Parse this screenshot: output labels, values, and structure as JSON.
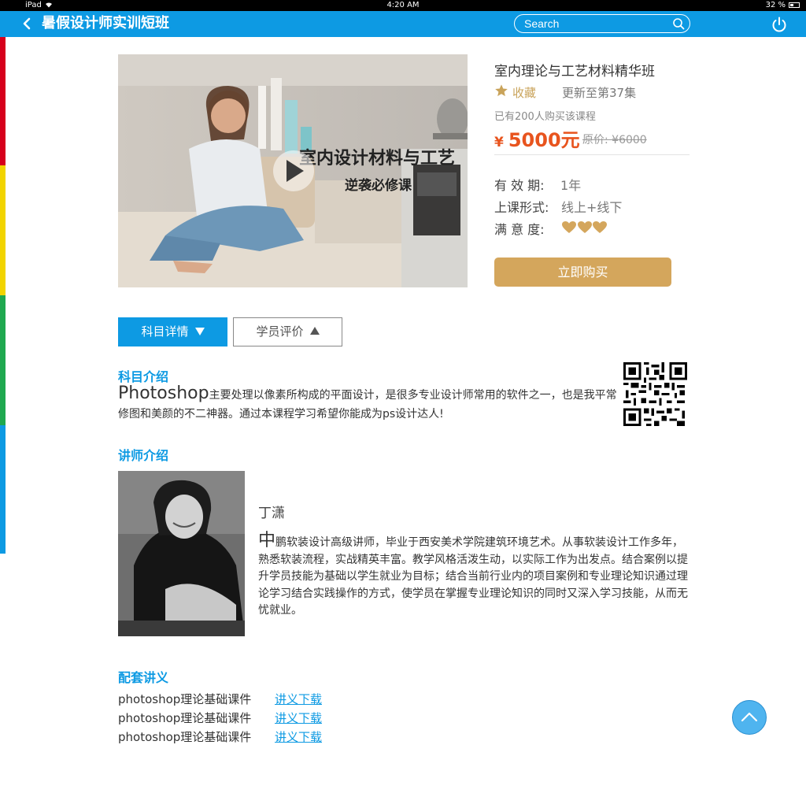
{
  "status_bar": {
    "device": "iPad",
    "time": "4:20 AM",
    "battery": "32 %"
  },
  "nav": {
    "title": "暑假设计师实训短班",
    "search_placeholder": "Search"
  },
  "course": {
    "video_caption_1": "室内设计材料与工艺",
    "video_caption_2": "逆袭必修课",
    "title": "室内理论与工艺材料精华班",
    "favorite_label": "收藏",
    "updated": "更新至第37集",
    "buyers": "已有200人购买该课程",
    "currency": "¥",
    "price": "5000元",
    "original_price": "原价: ¥6000",
    "validity_label": "有 效 期:",
    "validity_value": "1年",
    "mode_label": "上课形式:",
    "mode_value": "线上+线下",
    "satisfaction_label": "满 意 度:",
    "satisfaction_hearts": 3,
    "buy_button": "立即购买"
  },
  "tabs": {
    "details": "科目详情",
    "reviews": "学员评价"
  },
  "intro": {
    "heading": "科目介绍",
    "lead": "Photoshop",
    "text": "主要处理以像素所构成的平面设计，是很多专业设计师常用的软件之一，也是我平常修图和美颜的不二神器。通过本课程学习希望你能成为ps设计达人!"
  },
  "teacher": {
    "heading": "讲师介绍",
    "name": "丁潇",
    "bio_lead": "中",
    "bio": "鹏软装设计高级讲师，毕业于西安美术学院建筑环境艺术。从事软装设计工作多年，熟悉软装流程，实战精英丰富。教学风格活泼生动，以实际工作为出发点。结合案例以提升学员技能为基础以学生就业为目标；结合当前行业内的项目案例和专业理论知识通过理论学习结合实践操作的方式，使学员在掌握专业理论知识的同时又深入学习技能，从而无忧就业。"
  },
  "materials": {
    "heading": "配套讲义",
    "items": [
      {
        "name": "photoshop理论基础课件",
        "link": "讲义下载"
      },
      {
        "name": "photoshop理论基础课件",
        "link": "讲义下载"
      },
      {
        "name": "photoshop理论基础课件",
        "link": "讲义下载"
      }
    ]
  },
  "colors": {
    "primary": "#0d9ae3",
    "gold": "#d4a65c",
    "price": "#e8541e",
    "strip": [
      "#d6001c",
      "#f2d400",
      "#1fa84f",
      "#0d9ae3"
    ]
  }
}
